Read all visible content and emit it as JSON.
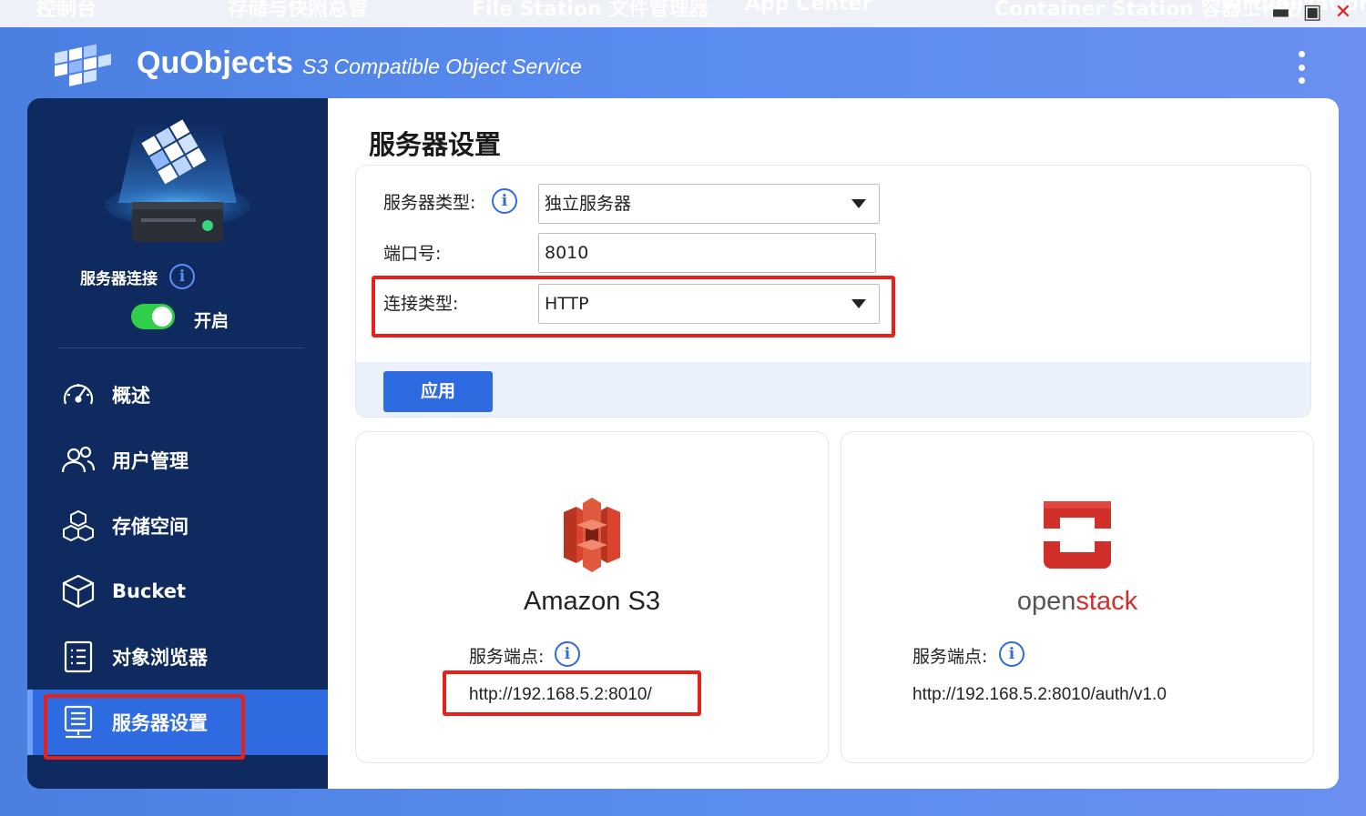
{
  "taskbar": {
    "items": [
      "控制台",
      "存储与快照总管",
      "File Station 文件管理器",
      "App Center",
      "Container Station 容器工作站",
      "Virtualization Station"
    ],
    "minimize_icon": "minimize-icon",
    "maximize_icon": "maximize-icon",
    "close_icon": "close-icon"
  },
  "app": {
    "title": "QuObjects",
    "subtitle": "S3 Compatible Object Service",
    "more_icon": "kebab-menu-icon"
  },
  "sidebar": {
    "connection_label": "服务器连接",
    "connection_info_icon": "i",
    "toggle_on": true,
    "toggle_label": "开启",
    "items": [
      {
        "label": "概述",
        "icon": "speedometer-icon",
        "active": false
      },
      {
        "label": "用户管理",
        "icon": "users-icon",
        "active": false
      },
      {
        "label": "存储空间",
        "icon": "cubes-icon",
        "active": false
      },
      {
        "label": "Bucket",
        "icon": "bucket-cube-icon",
        "active": false
      },
      {
        "label": "对象浏览器",
        "icon": "list-document-icon",
        "active": false
      },
      {
        "label": "服务器设置",
        "icon": "server-settings-icon",
        "active": true
      }
    ]
  },
  "main": {
    "title": "服务器设置",
    "form": {
      "server_type_label": "服务器类型:",
      "server_type_value": "独立服务器",
      "port_label": "端口号:",
      "port_value": "8010",
      "conn_type_label": "连接类型:",
      "conn_type_value": "HTTP",
      "apply_label": "应用",
      "info_glyph": "i"
    },
    "services": [
      {
        "name": "Amazon S3",
        "endpoint_label": "服务端点:",
        "endpoint": "http://192.168.5.2:8010/",
        "logo": "amazon-s3-logo",
        "color": "#d9432f"
      },
      {
        "name_part1": "open",
        "name_part2": "stack",
        "endpoint_label": "服务端点:",
        "endpoint": "http://192.168.5.2:8010/auth/v1.0",
        "logo": "openstack-logo",
        "color": "#d1302a"
      }
    ]
  },
  "colors": {
    "accent": "#2f6be0",
    "sidebar_bg": "#0f2a5e",
    "toggle_on": "#2fcf4a",
    "highlight": "#e8201a"
  }
}
